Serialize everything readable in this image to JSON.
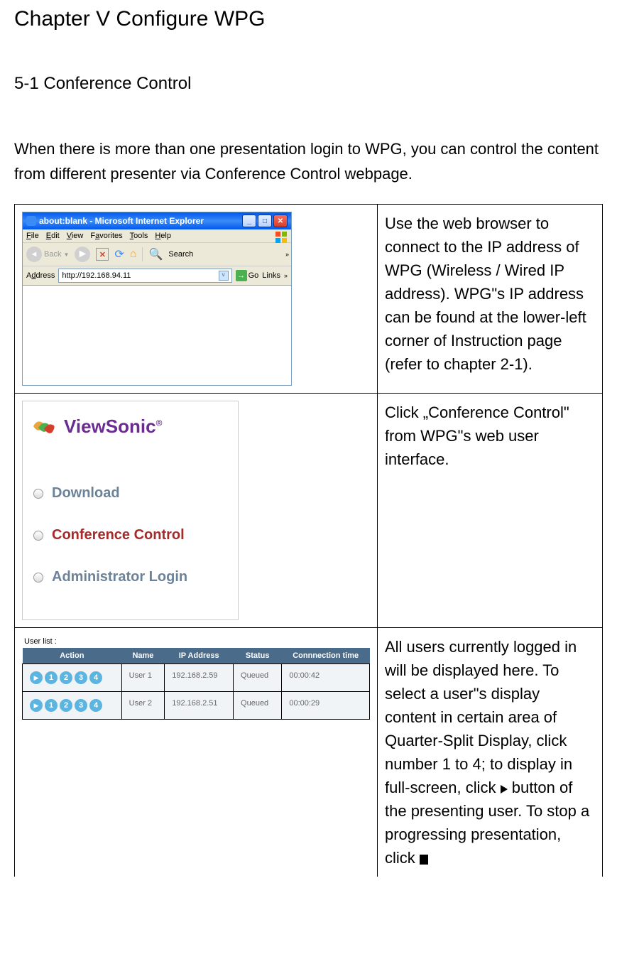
{
  "chapter_title": "Chapter V Configure WPG",
  "section_title": "5-1 Conference Control",
  "intro_text": "When there is more than one presentation login to WPG, you can control the content from different presenter via Conference Control webpage.",
  "row1": {
    "browser": {
      "title": "about:blank - Microsoft Internet Explorer",
      "menu": [
        "File",
        "Edit",
        "View",
        "Favorites",
        "Tools",
        "Help"
      ],
      "back_label": "Back",
      "search_label": "Search",
      "address_label": "Address",
      "url": "http://192.168.94.11",
      "go_label": "Go",
      "links_label": "Links"
    },
    "description": "Use the web browser to connect to the IP address of WPG (Wireless / Wired IP address). WPG\"s IP address can be found at the lower-left corner of Instruction page (refer to chapter 2-1)."
  },
  "row2": {
    "logo_text": "ViewSonic",
    "menu_items": {
      "download": "Download",
      "conference": "Conference Control",
      "admin": "Administrator Login"
    },
    "description": "Click „Conference Control\" from WPG\"s web user interface."
  },
  "row3": {
    "user_list_label": "User list :",
    "headers": {
      "action": "Action",
      "name": "Name",
      "ip": "IP Address",
      "status": "Status",
      "conn_time": "Connnection time"
    },
    "rows": [
      {
        "name": "User 1",
        "ip": "192.168.2.59",
        "status": "Queued",
        "time": "00:00:42"
      },
      {
        "name": "User 2",
        "ip": "192.168.2.51",
        "status": "Queued",
        "time": "00:00:29"
      }
    ],
    "description_part1": "All users currently logged in will be displayed here. To select a user\"s display content in certain area of Quarter-Split Display, click number 1 to 4; to display in full-screen, click ",
    "description_part2": "button of the presenting user. To stop a progressing presentation, click "
  }
}
